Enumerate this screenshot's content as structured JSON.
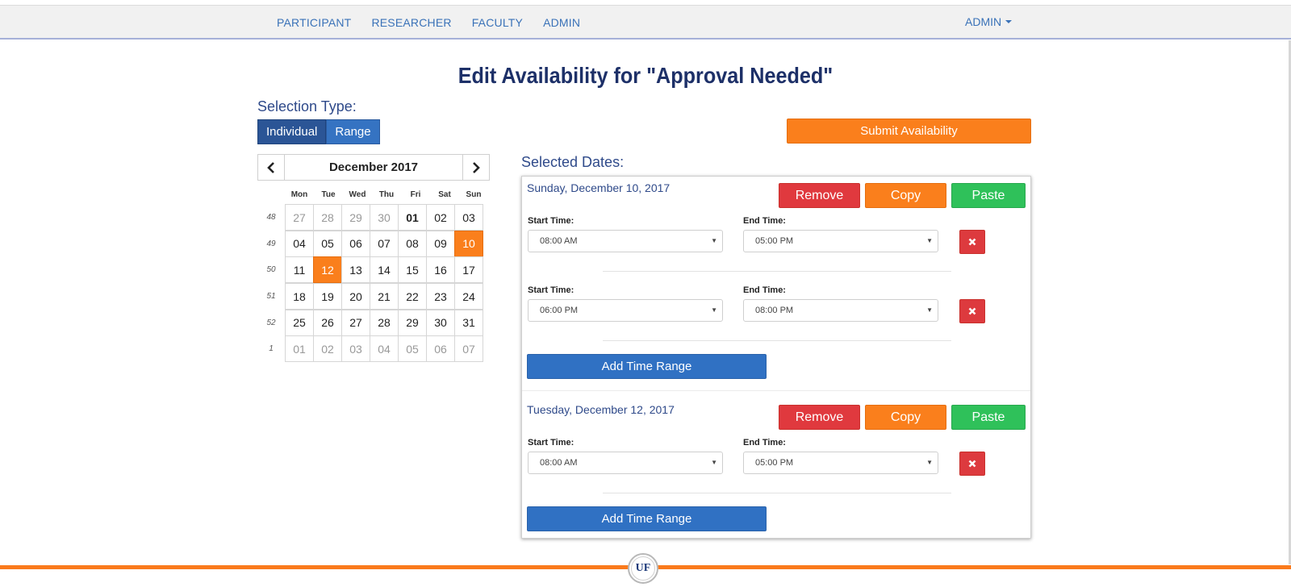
{
  "nav": {
    "items": [
      "PARTICIPANT",
      "RESEARCHER",
      "FACULTY",
      "ADMIN"
    ],
    "user_menu": "ADMIN"
  },
  "title": "Edit Availability for \"Approval Needed\"",
  "selection": {
    "label": "Selection Type:",
    "options": [
      "Individual",
      "Range"
    ],
    "active": "Individual"
  },
  "submit_label": "Submit Availability",
  "calendar": {
    "month_label": "December 2017",
    "prev_icon": "chevron-left-icon",
    "next_icon": "chevron-right-icon",
    "days_of_week": [
      "Mon",
      "Tue",
      "Wed",
      "Thu",
      "Fri",
      "Sat",
      "Sun"
    ],
    "weeks": [
      {
        "num": "48",
        "days": [
          "27",
          "28",
          "29",
          "30",
          "01",
          "02",
          "03"
        ]
      },
      {
        "num": "49",
        "days": [
          "04",
          "05",
          "06",
          "07",
          "08",
          "09",
          "10"
        ]
      },
      {
        "num": "50",
        "days": [
          "11",
          "12",
          "13",
          "14",
          "15",
          "16",
          "17"
        ]
      },
      {
        "num": "51",
        "days": [
          "18",
          "19",
          "20",
          "21",
          "22",
          "23",
          "24"
        ]
      },
      {
        "num": "52",
        "days": [
          "25",
          "26",
          "27",
          "28",
          "29",
          "30",
          "31"
        ]
      },
      {
        "num": "1",
        "days": [
          "01",
          "02",
          "03",
          "04",
          "05",
          "06",
          "07"
        ]
      }
    ],
    "selected": [
      "10",
      "12"
    ],
    "today": "01",
    "selected_color": "#fa7f1c"
  },
  "selected_dates": {
    "label": "Selected Dates:",
    "blocks": [
      {
        "date": "Sunday, December 10, 2017",
        "remove": "Remove",
        "copy": "Copy",
        "paste": "Paste",
        "ranges": [
          {
            "start_label": "Start Time:",
            "start": "08:00 AM",
            "end_label": "End Time:",
            "end": "05:00 PM"
          },
          {
            "start_label": "Start Time:",
            "start": "06:00 PM",
            "end_label": "End Time:",
            "end": "08:00 PM"
          }
        ],
        "add_label": "Add Time Range"
      },
      {
        "date": "Tuesday, December 12, 2017",
        "remove": "Remove",
        "copy": "Copy",
        "paste": "Paste",
        "ranges": [
          {
            "start_label": "Start Time:",
            "start": "08:00 AM",
            "end_label": "End Time:",
            "end": "05:00 PM"
          }
        ],
        "add_label": "Add Time Range"
      }
    ]
  },
  "colors": {
    "primary": "#3071c3",
    "accent": "#fa7f1c",
    "danger": "#e0393e",
    "success": "#2fc15a",
    "title": "#1d3068"
  },
  "footer": {
    "logo_text": "UF"
  }
}
